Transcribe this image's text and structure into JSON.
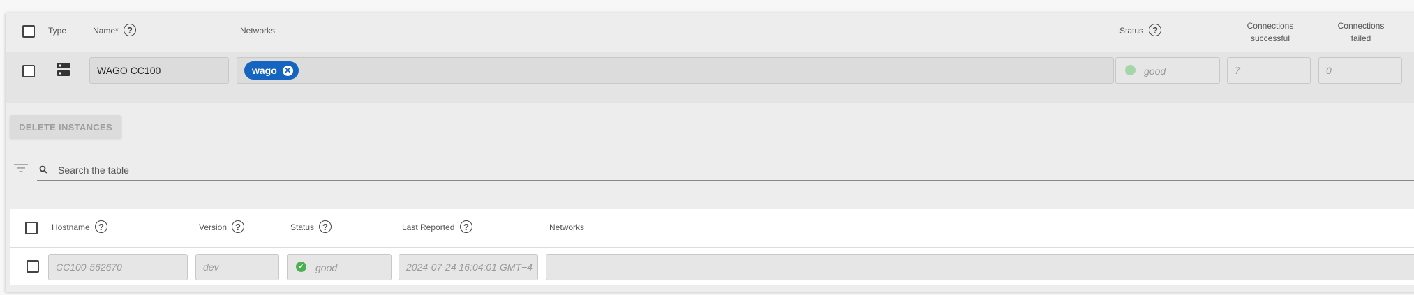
{
  "main_table": {
    "headers": {
      "type": "Type",
      "name": "Name*",
      "networks": "Networks",
      "status": "Status",
      "conn_success_1": "Connections",
      "conn_success_2": "successful",
      "conn_failed_1": "Connections",
      "conn_failed_2": "failed"
    },
    "row": {
      "type_icon": "server-icon",
      "name": "WAGO CC100",
      "network_chip": "wago",
      "status": "good",
      "connections_successful": "7",
      "connections_failed": "0"
    }
  },
  "actions": {
    "delete_label": "DELETE INSTANCES"
  },
  "search": {
    "placeholder": "Search the table"
  },
  "sub_table": {
    "headers": {
      "hostname": "Hostname",
      "version": "Version",
      "status": "Status",
      "last_reported": "Last Reported",
      "networks": "Networks"
    },
    "row": {
      "hostname": "CC100-562670",
      "version": "dev",
      "status": "good",
      "last_reported": "2024-07-24 16:04:01 GMT−4",
      "networks": ""
    }
  },
  "colors": {
    "chip": "#1565c0",
    "status_good": "#4caf50",
    "status_good_faded": "#a5d6a7"
  }
}
